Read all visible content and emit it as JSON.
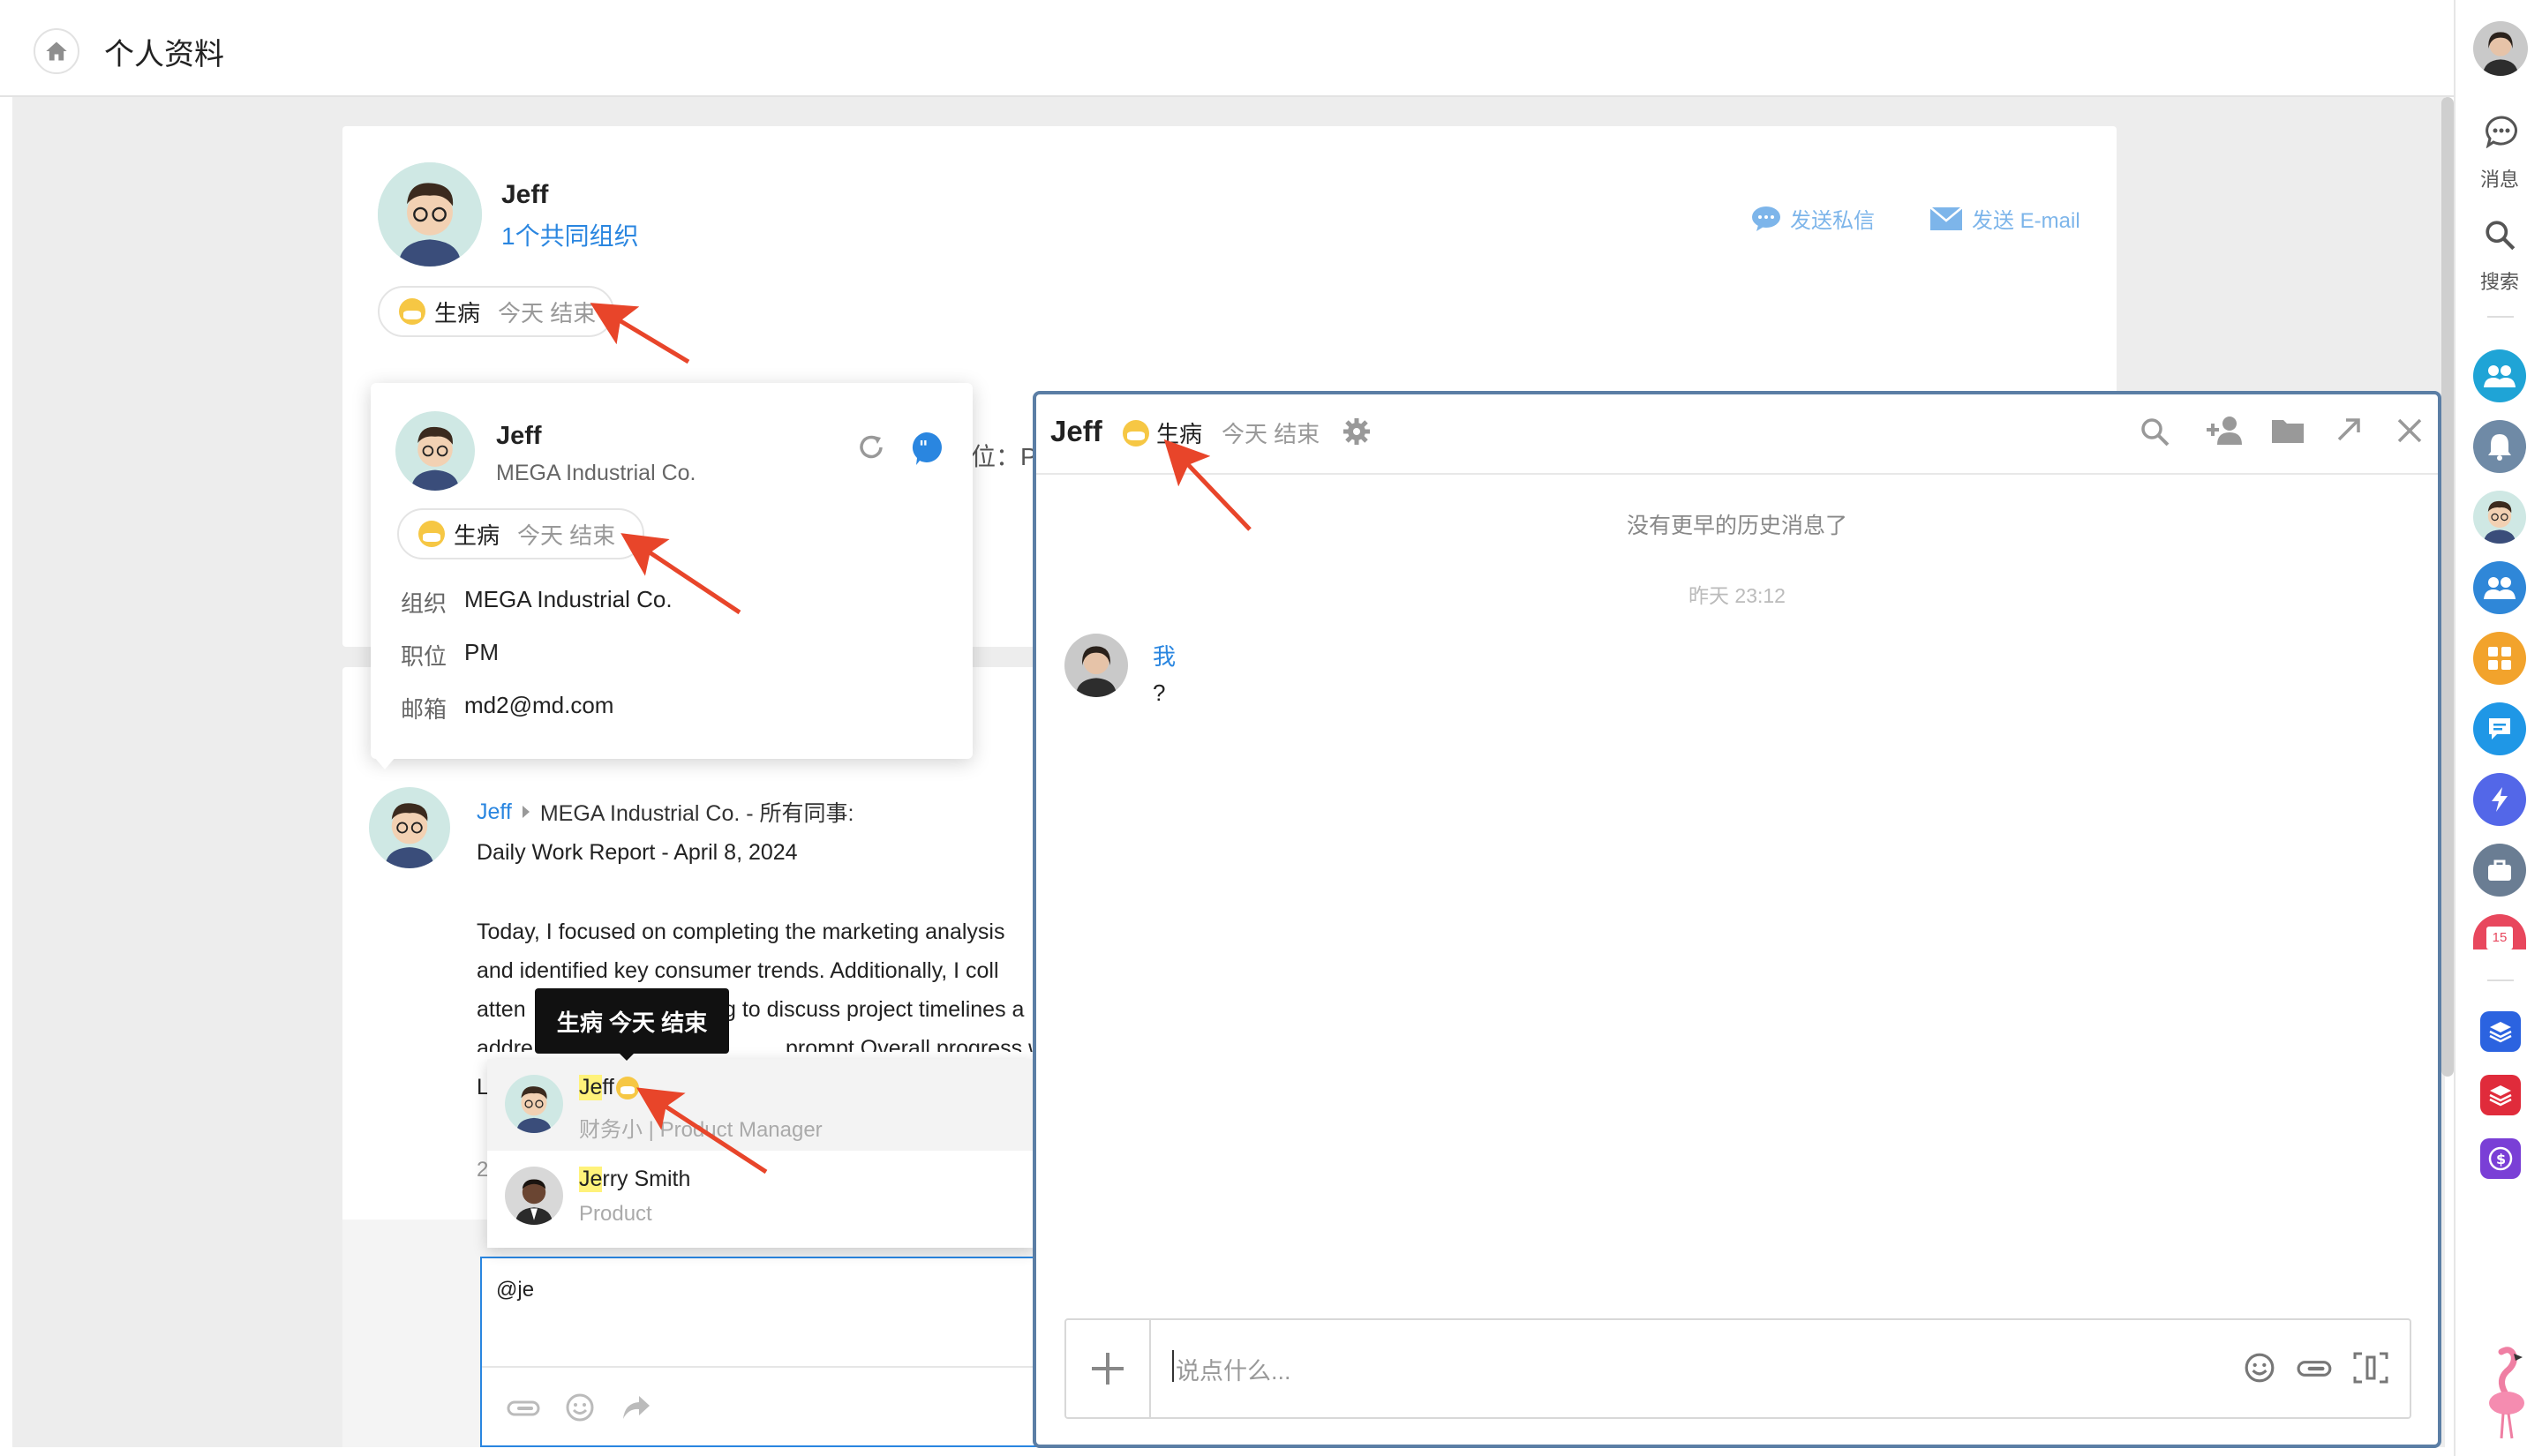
{
  "header": {
    "title": "个人资料"
  },
  "profile": {
    "name": "Jeff",
    "shared_orgs": "1个共同组织",
    "send_dm": "发送私信",
    "send_email": "发送 E-mail",
    "status": {
      "label": "生病",
      "end": "今天 结束"
    }
  },
  "popover": {
    "name": "Jeff",
    "company": "MEGA Industrial Co.",
    "status": {
      "label": "生病",
      "end": "今天 结束"
    },
    "fields": [
      {
        "label": "组织",
        "value": "MEGA Industrial Co."
      },
      {
        "label": "职位",
        "value": "PM"
      },
      {
        "label": "邮箱",
        "value": "md2@md.com"
      }
    ]
  },
  "hidden_partial": {
    "position": "位：P"
  },
  "post": {
    "author": "Jeff",
    "target": "MEGA Industrial Co. - 所有同事:",
    "title": "Daily Work Report - April 8, 2024",
    "lines": [
      "Today, I focused on completing the marketing analysis",
      "and identified key consumer trends. Additionally, I coll",
      "atten",
      "g to discuss project timelines a",
      "addre",
      "prompt  Overall  progress w",
      "L"
    ],
    "date_fragment": "2"
  },
  "tooltip": {
    "text": "生病 今天 结束"
  },
  "mention": {
    "input": "@je",
    "items": [
      {
        "name": "Jeff",
        "highlight": "Je",
        "rest": "ff",
        "sub": "财务小​ | Product Manager"
      },
      {
        "name": "Jerry Smith",
        "highlight": "Je",
        "rest": "rry Smith",
        "sub": "Product"
      }
    ]
  },
  "chat": {
    "title": "Jeff",
    "status": {
      "label": "生病",
      "end": "今天 结束"
    },
    "no_history": "没有更早的历史消息了",
    "timestamp": "昨天 23:12",
    "message": {
      "sender": "我",
      "text": "?"
    },
    "input_placeholder": "说点什么..."
  },
  "rightbar": {
    "messages_label": "消息",
    "search_label": "搜索",
    "calendar_day": "15"
  },
  "colors": {
    "accent": "#2a86e0",
    "arrow": "#e8452a",
    "window_border": "#5b7ea5",
    "status_yellow": "#f6c744"
  }
}
